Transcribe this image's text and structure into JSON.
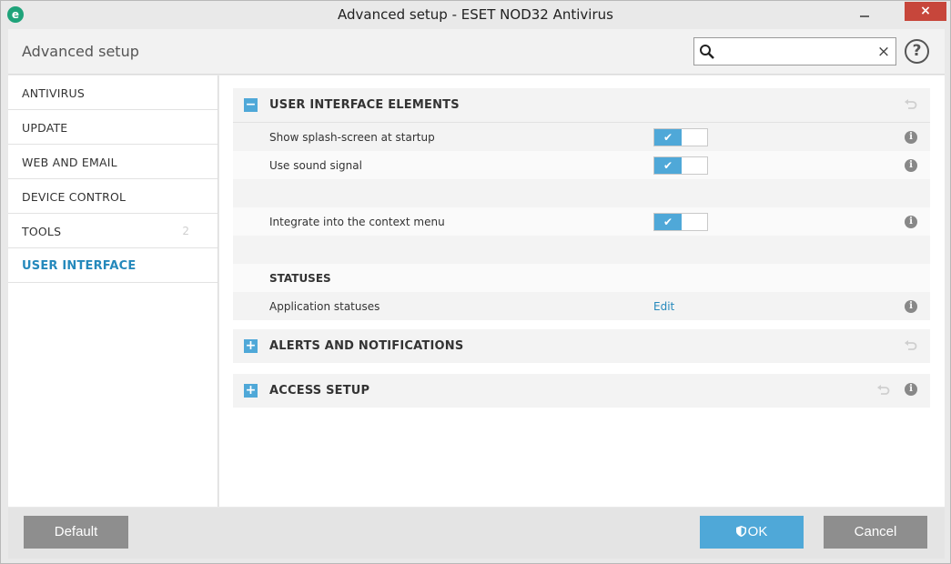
{
  "window": {
    "title": "Advanced setup - ESET NOD32 Antivirus",
    "app_icon_letter": "e",
    "minimize_icon": "minimize-icon",
    "close_label": "×"
  },
  "header": {
    "title": "Advanced setup",
    "search": {
      "value": "",
      "placeholder": ""
    },
    "clear_label": "×",
    "help_label": "?"
  },
  "sidebar": {
    "items": [
      {
        "label": "ANTIVIRUS",
        "count": ""
      },
      {
        "label": "UPDATE",
        "count": ""
      },
      {
        "label": "WEB AND EMAIL",
        "count": ""
      },
      {
        "label": "DEVICE CONTROL",
        "count": ""
      },
      {
        "label": "TOOLS",
        "count": "2"
      },
      {
        "label": "USER INTERFACE",
        "count": ""
      }
    ],
    "active_index": 5
  },
  "sections": {
    "ui_elements": {
      "toggle": "−",
      "title": "USER INTERFACE ELEMENTS",
      "rows": {
        "splash": {
          "label": "Show splash-screen at startup",
          "enabled": true
        },
        "sound": {
          "label": "Use sound signal",
          "enabled": true
        },
        "context": {
          "label": "Integrate into the context menu",
          "enabled": true
        }
      },
      "statuses_heading": "STATUSES",
      "app_statuses": {
        "label": "Application statuses",
        "action": "Edit"
      }
    },
    "alerts": {
      "toggle": "+",
      "title": "ALERTS AND NOTIFICATIONS"
    },
    "access": {
      "toggle": "+",
      "title": "ACCESS SETUP"
    }
  },
  "footer": {
    "default_label": "Default",
    "ok_label": "OK",
    "cancel_label": "Cancel"
  },
  "colors": {
    "accent": "#4fa8d8",
    "link": "#2589bc",
    "close": "#c7463b",
    "gray_button": "#8e8e8e"
  }
}
